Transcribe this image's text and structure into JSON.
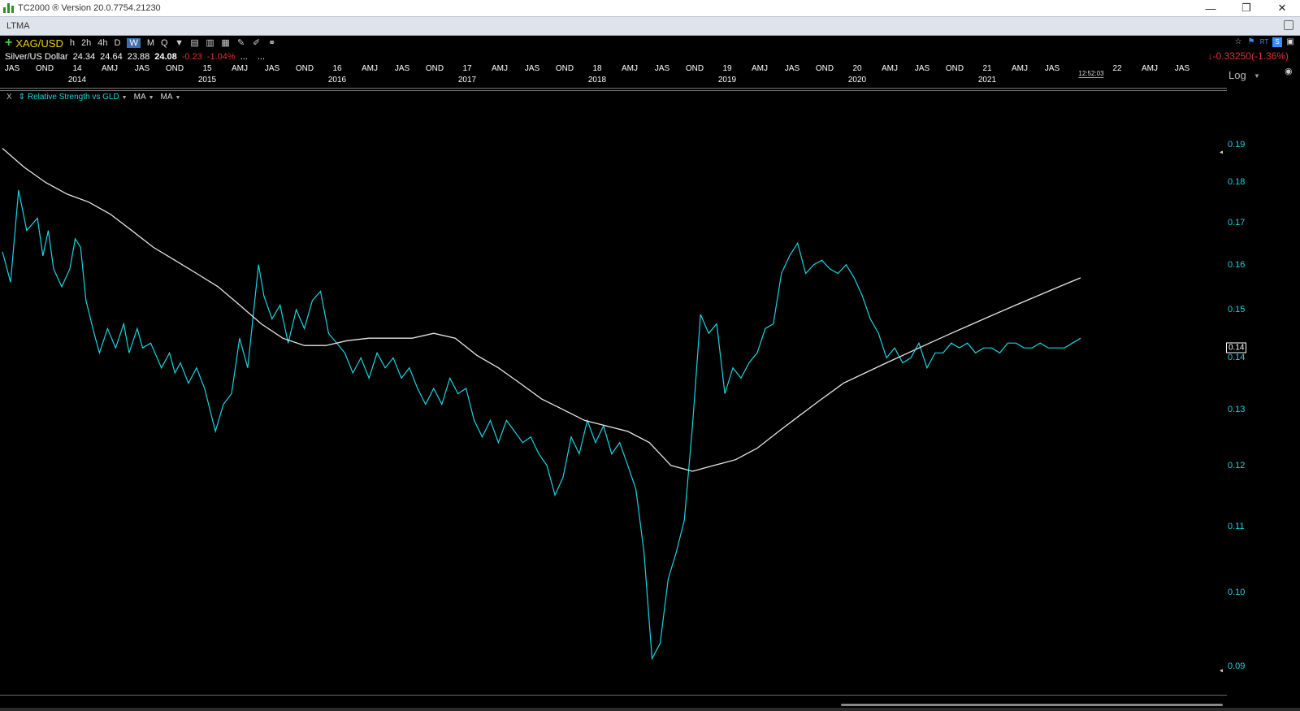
{
  "window": {
    "title": "TC2000 ® Version 20.0.7754.21230",
    "minimize": "—",
    "restore": "❐",
    "close": "✕"
  },
  "layout": {
    "name": "LTMA"
  },
  "toolbar": {
    "symbol": "XAG/USD",
    "timeframes": [
      "h",
      "2h",
      "4h",
      "D",
      "W",
      "M",
      "Q"
    ],
    "active_timeframe": "W"
  },
  "quote": {
    "name": "Silver/US Dollar",
    "open": "24.34",
    "high": "24.64",
    "low": "23.88",
    "last": "24.08",
    "change": "-0.23",
    "change_pct": "-1.04%",
    "more1": "...",
    "more2": "...",
    "right_change": "↓-0.33250(-1.36%)"
  },
  "time_axis": {
    "quarters": [
      "JAS",
      "OND",
      "AMJ",
      "JAS",
      "OND",
      "AMJ",
      "JAS",
      "OND",
      "AMJ",
      "JAS",
      "OND",
      "AMJ",
      "JAS",
      "OND",
      "AMJ",
      "JAS",
      "OND",
      "AMJ",
      "JAS",
      "OND",
      "AMJ",
      "JAS",
      "OND",
      "AMJ",
      "JAS"
    ],
    "year_short": [
      "14",
      "15",
      "16",
      "17",
      "18",
      "19",
      "20",
      "21",
      "22"
    ],
    "years": [
      "2014",
      "2015",
      "2016",
      "2017",
      "2018",
      "2019",
      "2020",
      "2021"
    ],
    "clock": "12:52:03"
  },
  "scale": {
    "label": "Log"
  },
  "indicator": {
    "close": "X",
    "name": "Relative Strength vs GLD",
    "ma1": "MA",
    "ma2": "MA"
  },
  "colors": {
    "rs_line": "#19d5e0",
    "ma_line": "#e6e6e6",
    "background": "#000000",
    "negative": "#e23030",
    "symbol": "#f0d000"
  },
  "chart_data": {
    "type": "line",
    "scale": "log",
    "ylim": [
      0.0895,
      0.192
    ],
    "yticks": [
      "0.19",
      "0.18",
      "0.17",
      "0.16",
      "0.15",
      "0.14",
      "0.13",
      "0.12",
      "0.11",
      "0.10",
      "0.09"
    ],
    "ytick_values": [
      0.19,
      0.18,
      0.17,
      0.16,
      0.15,
      0.14,
      0.13,
      0.12,
      0.11,
      0.1,
      0.09
    ],
    "current_value": "0.14",
    "x_unit": "weeks",
    "series": [
      {
        "key": "rs",
        "color": "#19d5e0",
        "x": [
          0,
          3,
          6,
          9,
          13,
          15,
          17,
          19,
          22,
          25,
          27,
          29,
          31,
          34,
          36,
          39,
          42,
          45,
          47,
          50,
          52,
          55,
          59,
          62,
          64,
          66,
          69,
          72,
          75,
          79,
          82,
          85,
          88,
          91,
          95,
          97,
          100,
          103,
          106,
          109,
          112,
          115,
          118,
          121,
          124,
          127,
          130,
          133,
          136,
          139,
          142,
          145,
          148,
          151,
          154,
          157,
          160,
          163,
          166,
          169,
          172,
          175,
          178,
          181,
          184,
          187,
          190,
          193,
          196,
          199,
          202,
          205,
          208,
          211,
          214,
          217,
          220,
          223,
          226,
          229,
          232,
          235,
          238,
          241,
          244,
          247,
          250,
          253,
          256,
          259,
          262,
          265,
          268,
          271,
          274,
          277,
          280,
          283,
          286,
          289,
          292,
          295,
          298,
          301,
          304,
          307,
          310,
          313,
          316,
          319,
          322,
          325,
          328,
          331,
          334,
          337,
          340,
          343,
          346,
          349,
          352,
          355,
          358,
          361,
          364,
          367,
          370,
          373,
          376,
          379,
          382,
          385,
          388,
          391,
          394,
          397,
          400
        ],
        "y": [
          0.163,
          0.156,
          0.178,
          0.168,
          0.171,
          0.162,
          0.168,
          0.159,
          0.155,
          0.159,
          0.166,
          0.164,
          0.152,
          0.145,
          0.141,
          0.146,
          0.142,
          0.147,
          0.141,
          0.146,
          0.142,
          0.143,
          0.138,
          0.141,
          0.137,
          0.139,
          0.135,
          0.138,
          0.134,
          0.126,
          0.131,
          0.133,
          0.144,
          0.138,
          0.16,
          0.153,
          0.148,
          0.151,
          0.143,
          0.15,
          0.146,
          0.152,
          0.154,
          0.145,
          0.143,
          0.141,
          0.137,
          0.14,
          0.136,
          0.141,
          0.138,
          0.14,
          0.136,
          0.138,
          0.134,
          0.131,
          0.134,
          0.131,
          0.136,
          0.133,
          0.134,
          0.128,
          0.125,
          0.128,
          0.124,
          0.128,
          0.126,
          0.124,
          0.125,
          0.122,
          0.12,
          0.115,
          0.118,
          0.125,
          0.122,
          0.128,
          0.124,
          0.127,
          0.122,
          0.124,
          0.12,
          0.116,
          0.106,
          0.091,
          0.093,
          0.102,
          0.106,
          0.111,
          0.127,
          0.149,
          0.145,
          0.147,
          0.133,
          0.138,
          0.136,
          0.139,
          0.141,
          0.146,
          0.147,
          0.158,
          0.162,
          0.165,
          0.158,
          0.16,
          0.161,
          0.159,
          0.158,
          0.16,
          0.157,
          0.153,
          0.148,
          0.145,
          0.14,
          0.142,
          0.139,
          0.14,
          0.143,
          0.138,
          0.141,
          0.141,
          0.143,
          0.142,
          0.143,
          0.141,
          0.142,
          0.142,
          0.141,
          0.143,
          0.143,
          0.142,
          0.142,
          0.143,
          0.142,
          0.142,
          0.142,
          0.143,
          0.144
        ]
      },
      {
        "key": "ma",
        "color": "#e6e6e6",
        "x": [
          0,
          8,
          16,
          24,
          32,
          40,
          48,
          56,
          64,
          72,
          80,
          88,
          96,
          104,
          112,
          120,
          128,
          136,
          144,
          152,
          160,
          168,
          176,
          184,
          192,
          200,
          208,
          216,
          224,
          232,
          240,
          248,
          256,
          264,
          272,
          280,
          288,
          296,
          304,
          312,
          320,
          328,
          336,
          344,
          352,
          360,
          368,
          376,
          384,
          392,
          400
        ],
        "y": [
          0.189,
          0.184,
          0.18,
          0.177,
          0.175,
          0.172,
          0.168,
          0.164,
          0.161,
          0.158,
          0.155,
          0.151,
          0.147,
          0.144,
          0.1425,
          0.1425,
          0.1435,
          0.144,
          0.144,
          0.144,
          0.145,
          0.144,
          0.1405,
          0.138,
          0.135,
          0.132,
          0.13,
          0.128,
          0.127,
          0.126,
          0.124,
          0.12,
          0.119,
          0.12,
          0.121,
          0.123,
          0.126,
          0.129,
          0.132,
          0.135,
          0.137,
          0.139,
          0.141,
          0.143,
          0.145,
          0.147,
          0.149,
          0.151,
          0.153,
          0.155,
          0.157
        ]
      }
    ]
  }
}
